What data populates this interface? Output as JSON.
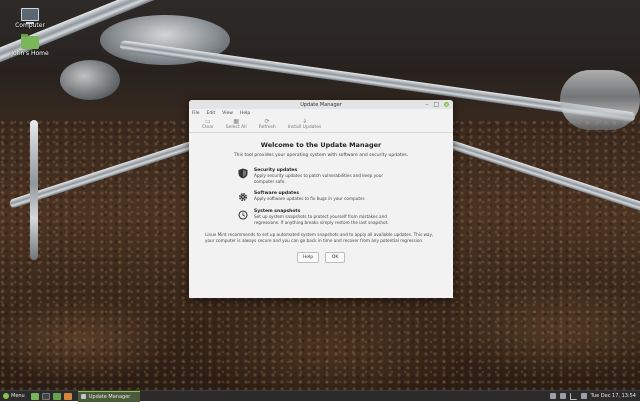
{
  "desktop": {
    "icons": [
      {
        "label": "Computer"
      },
      {
        "label": "John's Home"
      }
    ]
  },
  "window": {
    "title": "Update Manager",
    "controls": {
      "minimize": "–",
      "maximize": "□",
      "close": "×"
    },
    "menu": [
      "File",
      "Edit",
      "View",
      "Help"
    ],
    "toolbar": {
      "clear": "Clear",
      "select_all": "Select All",
      "refresh": "Refresh",
      "install": "Install Updates"
    },
    "welcome": {
      "heading": "Welcome to the Update Manager",
      "intro": "This tool provides your operating system with software and security updates.",
      "features": [
        {
          "icon": "shield-icon",
          "title": "Security updates",
          "desc": "Apply security updates to patch vulnerabilities and keep your computer safe."
        },
        {
          "icon": "gear-icon",
          "title": "Software updates",
          "desc": "Apply software updates to fix bugs in your computer."
        },
        {
          "icon": "clock-icon",
          "title": "System snapshots",
          "desc": "Set up system snapshots to protect yourself from mistakes and regressions. If anything breaks simply restore the last snapshot."
        }
      ],
      "recommendation": "Linux Mint recommends to set up automated system snapshots and to apply all available updates. This way, your computer is always secure and you can go back in time and recover from any potential regression."
    },
    "buttons": {
      "help": "Help",
      "ok": "OK"
    }
  },
  "panel": {
    "menu_label": "Menu",
    "task_label": "Update Manager",
    "clock": "Tue Dec 17, 13:54"
  }
}
